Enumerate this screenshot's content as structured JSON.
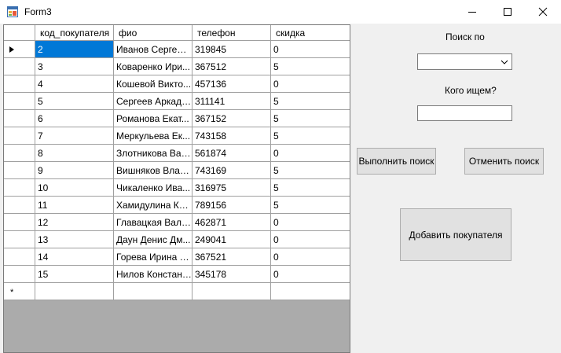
{
  "window": {
    "title": "Form3",
    "icon": "app-form-icon",
    "controls": [
      "minimize-icon",
      "maximize-icon",
      "close-icon"
    ]
  },
  "grid": {
    "columns": [
      "код_покупателя",
      "фио",
      "телефон",
      "скидка"
    ],
    "current_row_indicator": "triangle-right-icon",
    "new_row_marker": "*",
    "rows": [
      [
        "2",
        "Иванов Сергей ...",
        "319845",
        "0"
      ],
      [
        "3",
        "Коваренко Ири...",
        "367512",
        "5"
      ],
      [
        "4",
        "Кошевой Викто...",
        "457136",
        "0"
      ],
      [
        "5",
        "Сергеев Аркади...",
        "311141",
        "5"
      ],
      [
        "6",
        "Романова Екат...",
        "367152",
        "5"
      ],
      [
        "7",
        "Меркульева Ек...",
        "743158",
        "5"
      ],
      [
        "8",
        "Злотникова Вал...",
        "561874",
        "0"
      ],
      [
        "9",
        "Вишняков Влад...",
        "743169",
        "5"
      ],
      [
        "10",
        "Чикаленко Ива...",
        "316975",
        "5"
      ],
      [
        "11",
        "Хамидулина Кр...",
        "789156",
        "5"
      ],
      [
        "12",
        "Главацкая Вале...",
        "462871",
        "0"
      ],
      [
        "13",
        "Даун Денис Дм...",
        "249041",
        "0"
      ],
      [
        "14",
        "Горева Ирина А...",
        "367521",
        "0"
      ],
      [
        "15",
        "Нилов Констант...",
        "345178",
        "0"
      ]
    ]
  },
  "panel": {
    "search_by_label": "Поиск по",
    "search_by_value": "",
    "who_label": "Кого ищем?",
    "search_value": "",
    "search_button": "Выполнить поиск",
    "cancel_button": "Отменить поиск",
    "add_button": "Добавить покупателя"
  },
  "colors": {
    "selection": "#0078d7",
    "background": "#f0f0f0",
    "grid_empty_area": "#ababab"
  }
}
